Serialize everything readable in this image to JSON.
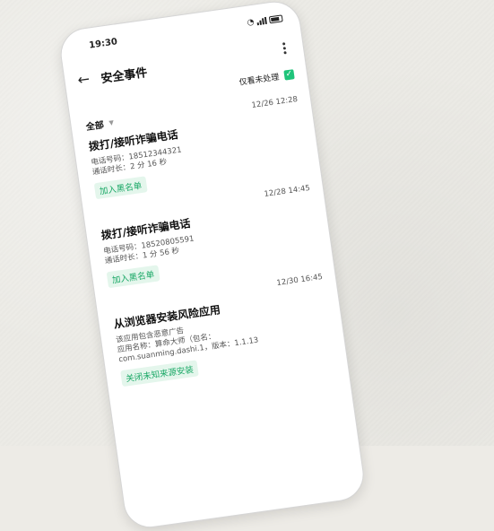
{
  "status": {
    "time": "19:30"
  },
  "header": {
    "title": "安全事件"
  },
  "filter": {
    "only_unhandled_label": "仅看未处理",
    "only_unhandled_checked": true,
    "category": "全部"
  },
  "events": [
    {
      "time": "12/26  12:28",
      "title": "拨打/接听诈骗电话",
      "lines": [
        "电话号码：18512344321",
        "通话时长：2 分 16 秒"
      ],
      "action": "加入黑名单"
    },
    {
      "time": "12/28  14:45",
      "title": "拨打/接听诈骗电话",
      "lines": [
        "电话号码：18520805591",
        "通话时长：1 分 56 秒"
      ],
      "action": "加入黑名单"
    },
    {
      "time": "12/30  16:45",
      "title": "从浏览器安装风险应用",
      "lines": [
        "该应用包含恶意广告",
        "应用名称：算命大师（包名：",
        "com.suanming.dashi.1，版本：1.1.13"
      ],
      "action": "关闭未知来源安装"
    }
  ],
  "colors": {
    "accent": "#1fc47a",
    "accent_text": "#1aa866",
    "accent_bg": "#e4f6ec"
  }
}
